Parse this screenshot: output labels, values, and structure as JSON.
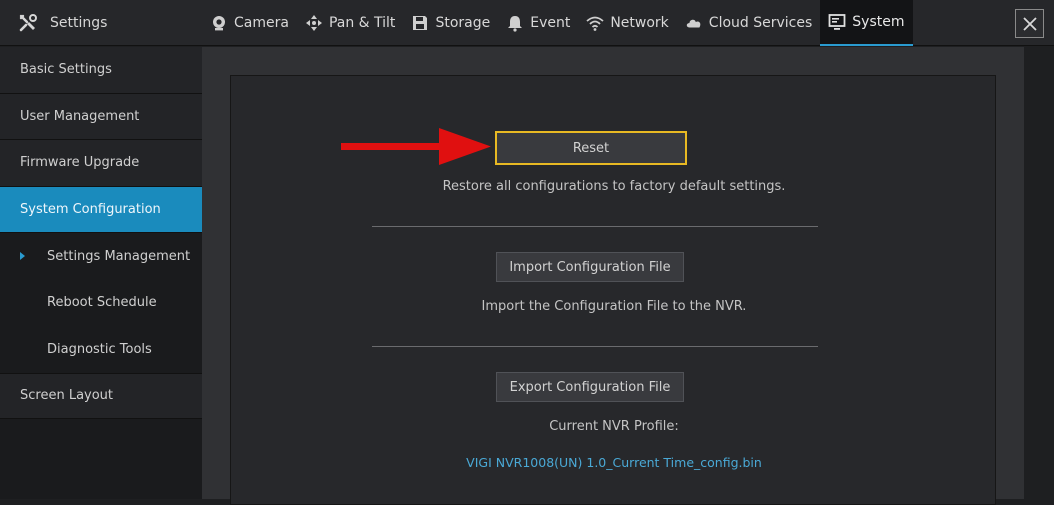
{
  "header": {
    "title": "Settings",
    "tabs": [
      {
        "label": "Camera",
        "icon": "camera-icon"
      },
      {
        "label": "Pan & Tilt",
        "icon": "pan-tilt-icon"
      },
      {
        "label": "Storage",
        "icon": "storage-icon"
      },
      {
        "label": "Event",
        "icon": "bell-icon"
      },
      {
        "label": "Network",
        "icon": "wifi-icon"
      },
      {
        "label": "Cloud Services",
        "icon": "cloud-icon"
      },
      {
        "label": "System",
        "icon": "monitor-icon",
        "active": true
      }
    ]
  },
  "sidebar": {
    "items": [
      {
        "label": "Basic Settings"
      },
      {
        "label": "User Management"
      },
      {
        "label": "Firmware Upgrade"
      },
      {
        "label": "System Configuration",
        "active": true
      },
      {
        "label": "Settings Management",
        "sub": true,
        "selected": true
      },
      {
        "label": "Reboot Schedule",
        "sub": true
      },
      {
        "label": "Diagnostic Tools",
        "sub": true
      },
      {
        "label": "Screen Layout"
      }
    ]
  },
  "main": {
    "reset": {
      "button_label": "Reset",
      "description": "Restore all configurations to factory default settings."
    },
    "import": {
      "button_label": "Import Configuration File",
      "description": "Import the Configuration File to the NVR."
    },
    "export": {
      "button_label": "Export Configuration File",
      "profile_label": "Current NVR Profile:",
      "profile_file": "VIGI NVR1008(UN) 1.0_Current Time_config.bin"
    }
  },
  "colors": {
    "accent": "#1a8bbd",
    "highlight": "#e8b923",
    "arrow": "#e01010",
    "link": "#4aa9d6"
  }
}
